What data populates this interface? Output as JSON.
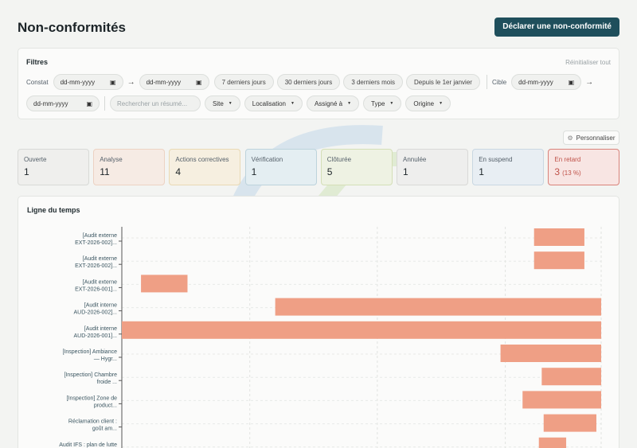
{
  "header": {
    "title": "Non-conformités",
    "declare_label": "Déclarer une non-conformité"
  },
  "filters": {
    "title": "Filtres",
    "reset_label": "Réinitialiser tout",
    "constat_label": "Constat",
    "cible_label": "Cible",
    "date_placeholder": "dd-mm-yyyy",
    "presets": [
      "7 derniers jours",
      "30 derniers jours",
      "3 derniers mois",
      "Depuis le 1er janvier"
    ],
    "search_placeholder": "Rechercher un résumé...",
    "dropdowns": [
      "Site",
      "Localisation",
      "Assigné à",
      "Type",
      "Origine"
    ]
  },
  "customize_label": "Personnaliser",
  "statuses": [
    {
      "label": "Ouverte",
      "count": "1",
      "bg": "#efefed",
      "border": "#d8dad7"
    },
    {
      "label": "Analyse",
      "count": "11",
      "bg": "#f6ebe4",
      "border": "#ecd2c3"
    },
    {
      "label": "Actions correctives",
      "count": "4",
      "bg": "#f6efe0",
      "border": "#e9d9b4"
    },
    {
      "label": "Vérification",
      "count": "1",
      "bg": "#e4eef2",
      "border": "#bdd3dc"
    },
    {
      "label": "Clôturée",
      "count": "5",
      "bg": "#eef2e3",
      "border": "#d4dfb7"
    },
    {
      "label": "Annulée",
      "count": "1",
      "bg": "#eeeeed",
      "border": "#d9d9d7"
    },
    {
      "label": "En suspend",
      "count": "1",
      "bg": "#e8eef3",
      "border": "#c9d7e2"
    },
    {
      "label": "En retard",
      "count": "3",
      "pct": "(13 %)",
      "bg": "#f8e5e3",
      "border": "#d9827a",
      "labelColor": "#c0534a",
      "countColor": "#c0534a"
    }
  ],
  "timeline": {
    "title": "Ligne du temps",
    "bar_color": "#ef9f85",
    "rows": [
      {
        "label1": "[Audit externe",
        "label2": "EXT-2026-002]...",
        "start": 0.86,
        "end": 0.965
      },
      {
        "label1": "[Audit externe",
        "label2": "EXT-2026-002]...",
        "start": 0.86,
        "end": 0.965
      },
      {
        "label1": "[Audit externe",
        "label2": "EXT-2026-001]...",
        "start": 0.04,
        "end": 0.137
      },
      {
        "label1": "[Audit interne",
        "label2": "AUD-2026-002]...",
        "start": 0.32,
        "end": 1.0
      },
      {
        "label1": "[Audit interne",
        "label2": "AUD-2026-001]...",
        "start": 0.0,
        "end": 1.0
      },
      {
        "label1": "[Inspection] Ambiance",
        "label2": "— Hygr...",
        "start": 0.79,
        "end": 1.0
      },
      {
        "label1": "[Inspection] Chambre",
        "label2": "froide ...",
        "start": 0.876,
        "end": 1.0
      },
      {
        "label1": "[Inspection] Zone de",
        "label2": "product...",
        "start": 0.836,
        "end": 1.0
      },
      {
        "label1": "Réclamation client :",
        "label2": "goût am...",
        "start": 0.88,
        "end": 0.99
      },
      {
        "label1": "Audit IFS : plan de lutte",
        "label2": "",
        "start": 0.87,
        "end": 0.927
      }
    ]
  }
}
